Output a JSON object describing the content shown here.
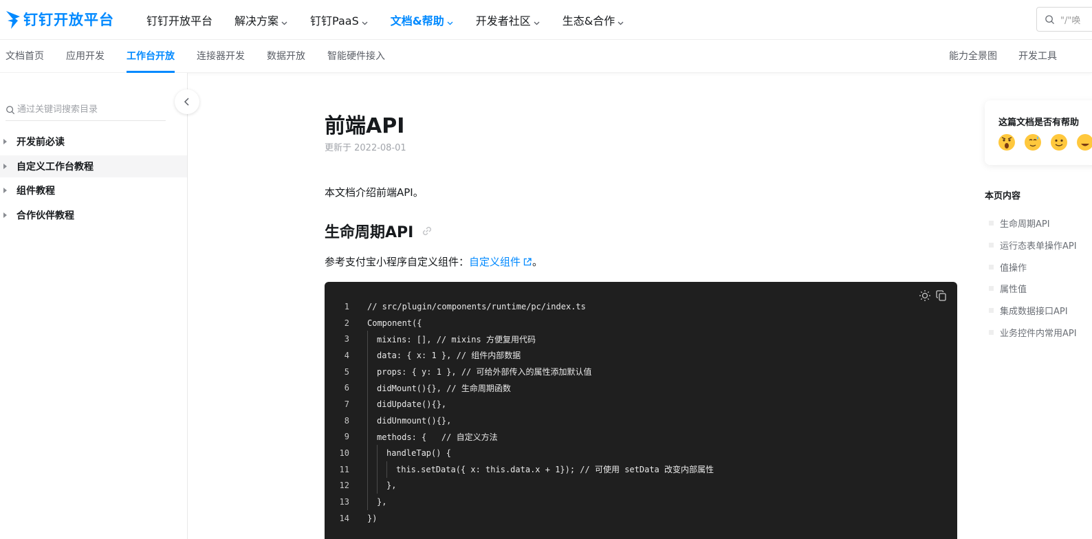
{
  "header": {
    "logo_text": "钉钉开放平台",
    "nav": [
      {
        "label": "钉钉开放平台",
        "dropdown": false,
        "active": false
      },
      {
        "label": "解决方案",
        "dropdown": true,
        "active": false
      },
      {
        "label": "钉钉PaaS",
        "dropdown": true,
        "active": false
      },
      {
        "label": "文档&帮助",
        "dropdown": true,
        "active": true
      },
      {
        "label": "开发者社区",
        "dropdown": true,
        "active": false
      },
      {
        "label": "生态&合作",
        "dropdown": true,
        "active": false
      }
    ],
    "search_placeholder": "\"/\"唤"
  },
  "subnav": {
    "items": [
      "文档首页",
      "应用开发",
      "工作台开放",
      "连接器开发",
      "数据开放",
      "智能硬件接入"
    ],
    "active_index": 2,
    "right_items": [
      "能力全景图",
      "开发工具"
    ]
  },
  "sidebar": {
    "search_placeholder": "通过关键词搜索目录",
    "items": [
      "开发前必读",
      "自定义工作台教程",
      "组件教程",
      "合作伙伴教程"
    ],
    "hover_index": 1
  },
  "main": {
    "title": "前端API",
    "updated": "更新于 2022-08-01",
    "intro": "本文档介绍前端API。",
    "section_title": "生命周期API",
    "ref_prefix": "参考支付宝小程序自定义组件：",
    "ref_link": "自定义组件",
    "ref_suffix": "。",
    "code": [
      {
        "n": "1",
        "indent": 0,
        "text": "// src/plugin/components/runtime/pc/index.ts"
      },
      {
        "n": "2",
        "indent": 0,
        "text": "Component({"
      },
      {
        "n": "3",
        "indent": 1,
        "text": "mixins: [], // mixins 方便复用代码"
      },
      {
        "n": "4",
        "indent": 1,
        "text": "data: { x: 1 }, // 组件内部数据"
      },
      {
        "n": "5",
        "indent": 1,
        "text": "props: { y: 1 }, // 可给外部传入的属性添加默认值"
      },
      {
        "n": "6",
        "indent": 1,
        "text": "didMount(){}, // 生命周期函数"
      },
      {
        "n": "7",
        "indent": 1,
        "text": "didUpdate(){},"
      },
      {
        "n": "8",
        "indent": 1,
        "text": "didUnmount(){},"
      },
      {
        "n": "9",
        "indent": 1,
        "text": "methods: {   // 自定义方法"
      },
      {
        "n": "10",
        "indent": 2,
        "text": "handleTap() {"
      },
      {
        "n": "11",
        "indent": 3,
        "text": "this.setData({ x: this.data.x + 1}); // 可使用 setData 改变内部属性"
      },
      {
        "n": "12",
        "indent": 2,
        "text": "},"
      },
      {
        "n": "13",
        "indent": 1,
        "text": "},"
      },
      {
        "n": "14",
        "indent": 0,
        "text": "})"
      }
    ]
  },
  "right_panel": {
    "feedback_question": "这篇文档是否有帮助",
    "emojis": [
      "angry-face-icon",
      "sweat-face-icon",
      "smile-face-icon",
      "happy-face-icon"
    ],
    "toc_title": "本页内容",
    "toc": [
      "生命周期API",
      "运行态表单操作API",
      "值操作",
      "属性值",
      "集成数据接口API",
      "业务控件内常用API"
    ]
  },
  "colors": {
    "accent": "#0089ff",
    "code_bg": "#1f1f1f",
    "text": "#171a1d"
  }
}
